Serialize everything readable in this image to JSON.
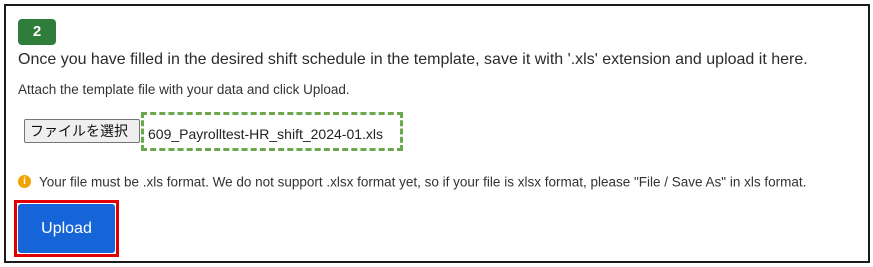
{
  "step": {
    "number": "2"
  },
  "instructions": {
    "main": "Once you have filled in the desired shift schedule in the template, save it with '.xls' extension and upload it here.",
    "hint": "Attach the template file with your data and click Upload."
  },
  "file_input": {
    "button_label": "ファイルを選択",
    "file_name": "609_Payrolltest-HR_shift_2024-01.xls"
  },
  "warning": {
    "icon": "info-icon",
    "text": "Your file must be .xls format. We do not support .xlsx format yet, so if your file is xlsx format, please \"File / Save As\" in xls format."
  },
  "actions": {
    "upload_label": "Upload"
  },
  "colors": {
    "badge": "#2f7d3a",
    "upload_button": "#1565d8",
    "highlight_red": "#e00000",
    "highlight_dashed_green": "#6aa84f",
    "warning_icon": "#f0a202"
  }
}
